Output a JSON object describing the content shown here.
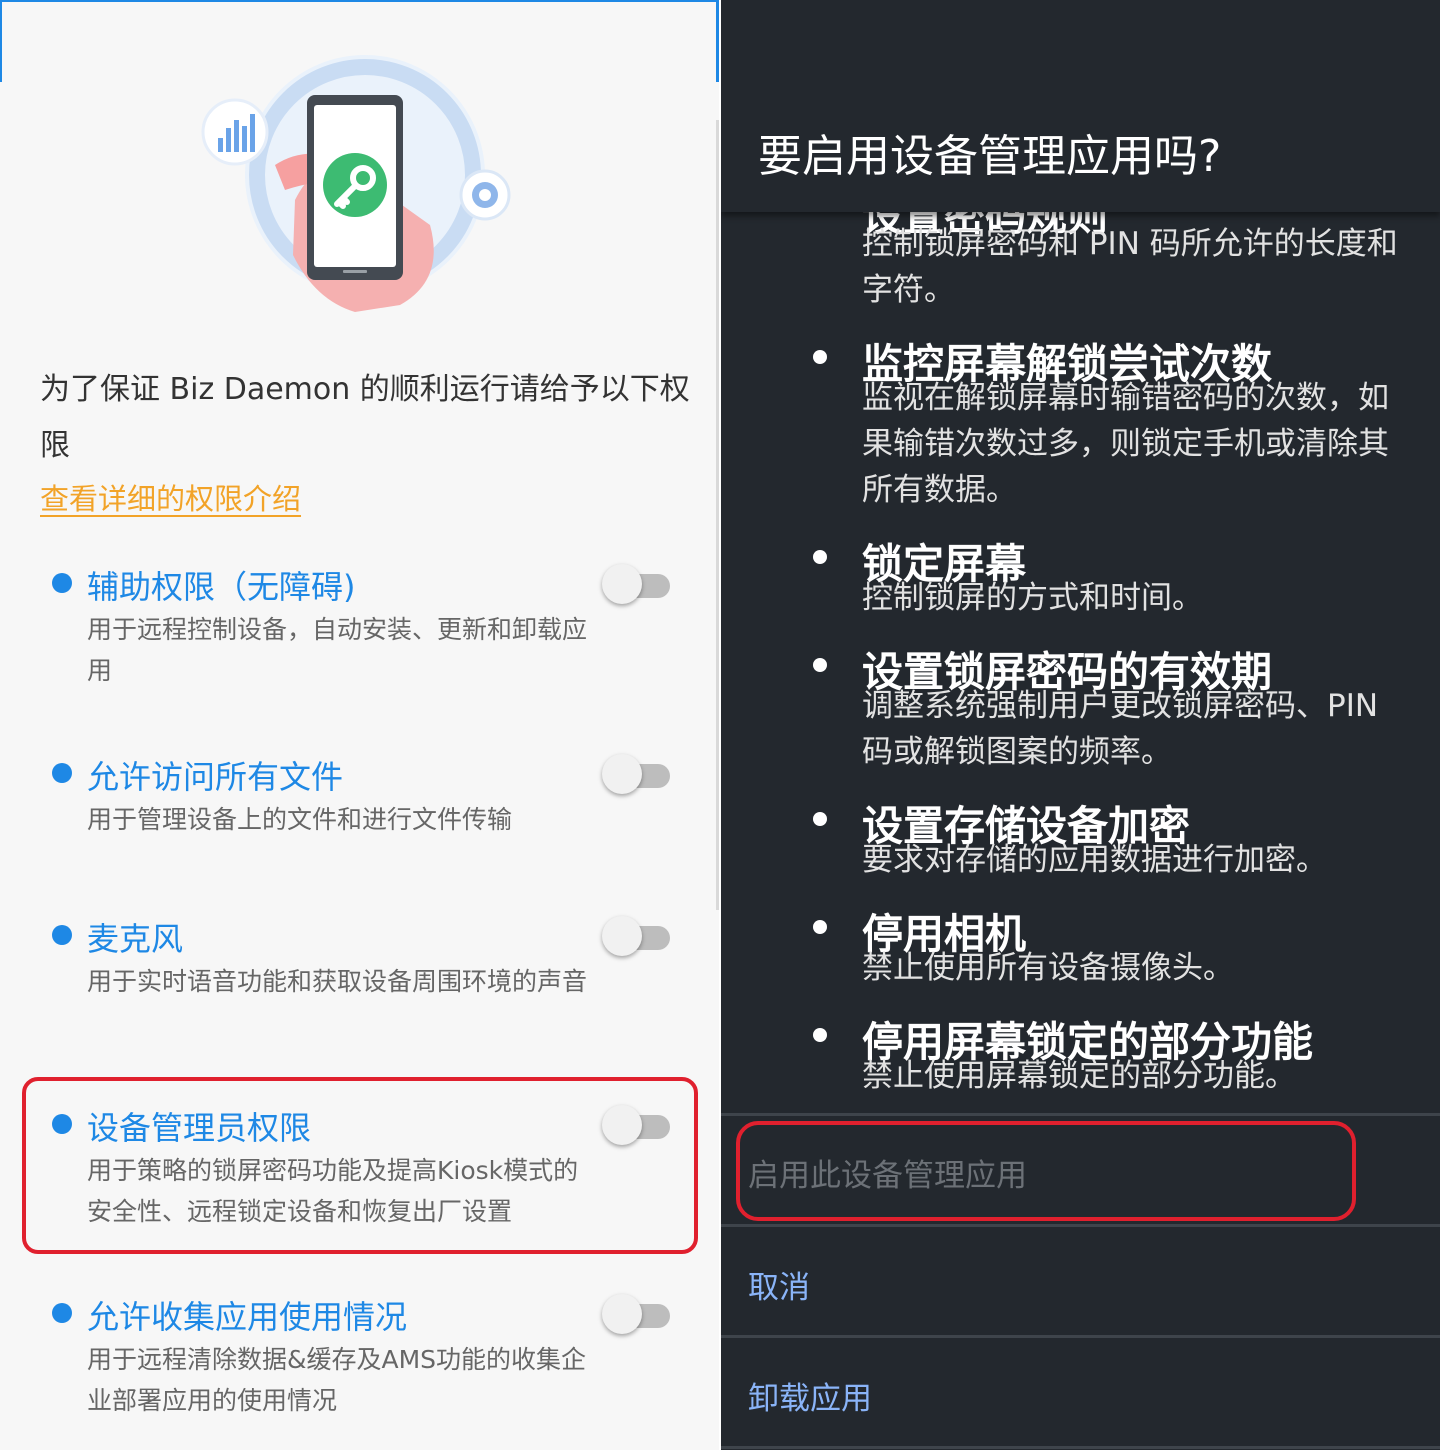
{
  "left": {
    "intro": "为了保证 Biz Daemon 的顺利运行请给予以下权限",
    "detail_link": "查看详细的权限介绍",
    "permissions": [
      {
        "title": "辅助权限（无障碍)",
        "desc": "用于远程控制设备，自动安装、更新和卸载应用",
        "enabled": false
      },
      {
        "title": "允许访问所有文件",
        "desc": "用于管理设备上的文件和进行文件传输",
        "enabled": false
      },
      {
        "title": "麦克风",
        "desc": "用于实时语音功能和获取设备周围环境的声音",
        "enabled": false
      },
      {
        "title": "设备管理员权限",
        "desc": "用于策略的锁屏密码功能及提高Kiosk模式的安全性、远程锁定设备和恢复出厂设置",
        "enabled": false
      },
      {
        "title": "允许收集应用使用情况",
        "desc": "用于远程清除数据&缓存及AMS功能的收集企业部署应用的使用情况",
        "enabled": false
      }
    ]
  },
  "right": {
    "dialog_title": "要启用设备管理应用吗?",
    "partial_policy_title": "设置密码规则",
    "partial_policy_desc": "控制锁屏密码和 PIN 码所允许的长度和字符。",
    "policies": [
      {
        "title": "监控屏幕解锁尝试次数",
        "desc": "监视在解锁屏幕时输错密码的次数，如果输错次数过多，则锁定手机或清除其所有数据。"
      },
      {
        "title": "锁定屏幕",
        "desc": "控制锁屏的方式和时间。"
      },
      {
        "title": "设置锁屏密码的有效期",
        "desc": "调整系统强制用户更改锁屏密码、PIN 码或解锁图案的频率。"
      },
      {
        "title": "设置存储设备加密",
        "desc": "要求对存储的应用数据进行加密。"
      },
      {
        "title": "停用相机",
        "desc": "禁止使用所有设备摄像头。"
      },
      {
        "title": "停用屏幕锁定的部分功能",
        "desc": "禁止使用屏幕锁定的部分功能。"
      }
    ],
    "buttons": {
      "enable": "启用此设备管理应用",
      "cancel": "取消",
      "uninstall": "卸载应用"
    }
  },
  "colors": {
    "accent_blue": "#1e88e5",
    "link_orange": "#f2a328",
    "highlight_red": "#e0202e",
    "dark_bg": "#23282e",
    "dialog_button_blue": "#8ab4f8"
  },
  "icons": [
    "bar-chart-icon",
    "key-icon",
    "pie-chart-icon"
  ]
}
